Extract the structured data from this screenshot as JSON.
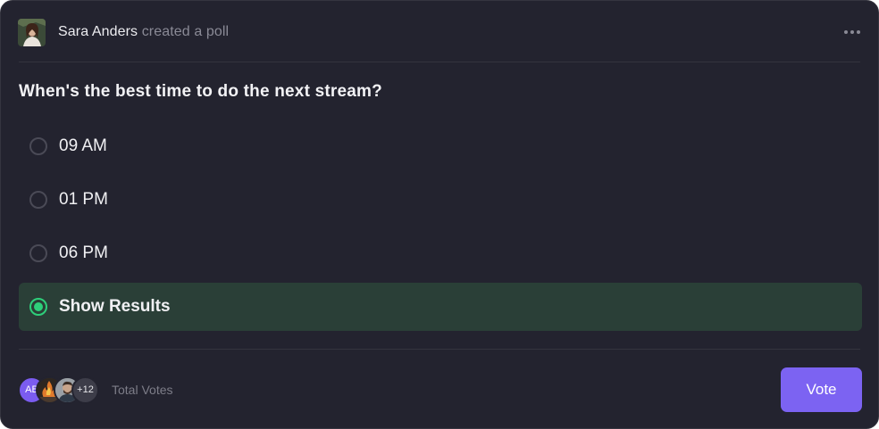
{
  "post": {
    "author": "Sara Anders",
    "action": "created a poll"
  },
  "poll": {
    "question": "When's the best time to do the next stream?",
    "options": [
      {
        "label": "09 AM",
        "selected": false
      },
      {
        "label": "01 PM",
        "selected": false
      },
      {
        "label": "06 PM",
        "selected": false
      },
      {
        "label": "Show Results",
        "selected": true
      }
    ]
  },
  "footer": {
    "voter_initials": "AB",
    "more_voters": "+12",
    "total_votes_label": "Total Votes",
    "vote_button": "Vote"
  },
  "colors": {
    "card_bg": "#23232f",
    "accent": "#7c63f2",
    "selected_bg": "#2a3f37",
    "selected_radio": "#2ecf7a"
  },
  "icons": {
    "more": "more-horizontal-icon",
    "author_avatar": "author-avatar-photo"
  }
}
